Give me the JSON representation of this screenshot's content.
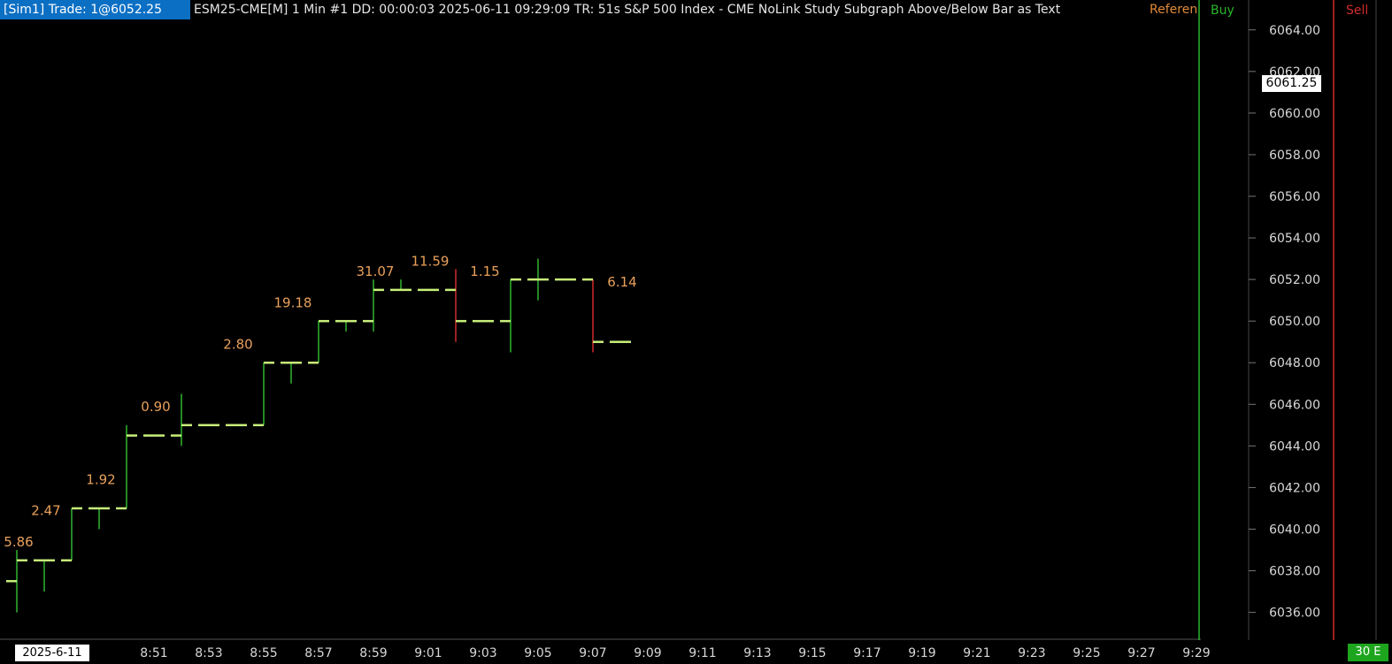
{
  "header": {
    "tag": "[Sim1]  Trade: 1@6052.25",
    "text": "ESM25-CME[M]  1 Min  #1 DD: 00:00:03 2025-06-11 09:29:09 TR: 51s S&P 500 Index - CME NoLink Study Subgraph Above/Below Bar as Text",
    "reference_label": "Referen"
  },
  "columns": {
    "buy_label": "Buy",
    "sell_label": "Sell"
  },
  "footer": {
    "date_label": "2025-6-11",
    "corner_label": "30 E"
  },
  "current_price_label": "6061.25",
  "colors": {
    "up": "#2fb52f",
    "down": "#d12a2a",
    "last": "#c8f07a",
    "label": "#e8a05a",
    "buy": "#2ab52a",
    "sell": "#d12a2a",
    "axis": "#d8d8d8"
  },
  "chart_data": {
    "type": "ohlc",
    "title": "",
    "y_ticks": [
      "6036.00",
      "6038.00",
      "6040.00",
      "6042.00",
      "6044.00",
      "6046.00",
      "6048.00",
      "6050.00",
      "6052.00",
      "6054.00",
      "6056.00",
      "6058.00",
      "6060.00",
      "6062.00",
      "6064.00"
    ],
    "y_range": [
      6034.75,
      6064.5
    ],
    "x_ticks": [
      {
        "bar": 5,
        "label": "8:51"
      },
      {
        "bar": 7,
        "label": "8:53"
      },
      {
        "bar": 9,
        "label": "8:55"
      },
      {
        "bar": 11,
        "label": "8:57"
      },
      {
        "bar": 13,
        "label": "8:59"
      },
      {
        "bar": 15,
        "label": "9:01"
      },
      {
        "bar": 17,
        "label": "9:03"
      },
      {
        "bar": 19,
        "label": "9:05"
      },
      {
        "bar": 21,
        "label": "9:07"
      },
      {
        "bar": 23,
        "label": "9:09"
      },
      {
        "bar": 25,
        "label": "9:11"
      },
      {
        "bar": 27,
        "label": "9:13"
      },
      {
        "bar": 29,
        "label": "9:15"
      },
      {
        "bar": 31,
        "label": "9:17"
      },
      {
        "bar": 33,
        "label": "9:19"
      },
      {
        "bar": 35,
        "label": "9:21"
      },
      {
        "bar": 37,
        "label": "9:23"
      },
      {
        "bar": 39,
        "label": "9:25"
      },
      {
        "bar": 41,
        "label": "9:27"
      },
      {
        "bar": 43,
        "label": "9:29"
      }
    ],
    "bars": [
      {
        "o": 6037.5,
        "h": 6039.0,
        "l": 6036.0,
        "c": 6038.5,
        "t": "5.86",
        "tp": 6039.0
      },
      {
        "o": 6038.5,
        "h": 6038.5,
        "l": 6037.0,
        "c": 6038.5,
        "t": "2.47",
        "tp": 6040.5
      },
      {
        "o": 6038.5,
        "h": 6041.0,
        "l": 6038.5,
        "c": 6041.0,
        "t": "",
        "tp": null
      },
      {
        "o": 6041.0,
        "h": 6041.0,
        "l": 6040.0,
        "c": 6041.0,
        "t": "1.92",
        "tp": 6042.0
      },
      {
        "o": 6041.0,
        "h": 6045.0,
        "l": 6041.0,
        "c": 6044.5,
        "t": "",
        "tp": null
      },
      {
        "o": 6044.5,
        "h": 6044.5,
        "l": 6044.5,
        "c": 6044.5,
        "t": "0.90",
        "tp": 6045.5
      },
      {
        "o": 6044.5,
        "h": 6046.5,
        "l": 6044.0,
        "c": 6045.0,
        "t": "",
        "tp": null
      },
      {
        "o": 6045.0,
        "h": 6045.0,
        "l": 6045.0,
        "c": 6045.0,
        "t": "",
        "tp": null
      },
      {
        "o": 6045.0,
        "h": 6045.0,
        "l": 6045.0,
        "c": 6045.0,
        "t": "2.80",
        "tp": 6048.5
      },
      {
        "o": 6045.0,
        "h": 6048.0,
        "l": 6045.0,
        "c": 6048.0,
        "t": "",
        "tp": null
      },
      {
        "o": 6048.0,
        "h": 6048.0,
        "l": 6047.0,
        "c": 6048.0,
        "t": "19.18",
        "tp": 6050.5
      },
      {
        "o": 6048.0,
        "h": 6050.0,
        "l": 6048.0,
        "c": 6050.0,
        "t": "",
        "tp": null
      },
      {
        "o": 6050.0,
        "h": 6050.0,
        "l": 6049.5,
        "c": 6050.0,
        "t": "",
        "tp": null
      },
      {
        "o": 6050.0,
        "h": 6052.0,
        "l": 6049.5,
        "c": 6051.5,
        "t": "31.07",
        "tp": 6052.0
      },
      {
        "o": 6051.5,
        "h": 6052.0,
        "l": 6051.5,
        "c": 6051.5,
        "t": "",
        "tp": null
      },
      {
        "o": 6051.5,
        "h": 6051.5,
        "l": 6051.5,
        "c": 6051.5,
        "t": "11.59",
        "tp": 6052.5
      },
      {
        "o": 6051.5,
        "h": 6052.5,
        "l": 6049.0,
        "c": 6050.0,
        "t": "",
        "tp": null
      },
      {
        "o": 6050.0,
        "h": 6050.0,
        "l": 6050.0,
        "c": 6050.0,
        "t": "1.15",
        "tp": 6052.0
      },
      {
        "o": 6050.0,
        "h": 6052.0,
        "l": 6048.5,
        "c": 6052.0,
        "t": "",
        "tp": null
      },
      {
        "o": 6052.0,
        "h": 6053.0,
        "l": 6051.0,
        "c": 6052.0,
        "t": "",
        "tp": null
      },
      {
        "o": 6052.0,
        "h": 6052.0,
        "l": 6052.0,
        "c": 6052.0,
        "t": "",
        "tp": null
      },
      {
        "o": 6052.0,
        "h": 6052.0,
        "l": 6048.5,
        "c": 6049.0,
        "t": "",
        "tp": null
      },
      {
        "o": 6049.0,
        "h": 6049.0,
        "l": 6049.0,
        "c": 6049.0,
        "t": "6.14",
        "tp": 6051.5
      }
    ]
  }
}
